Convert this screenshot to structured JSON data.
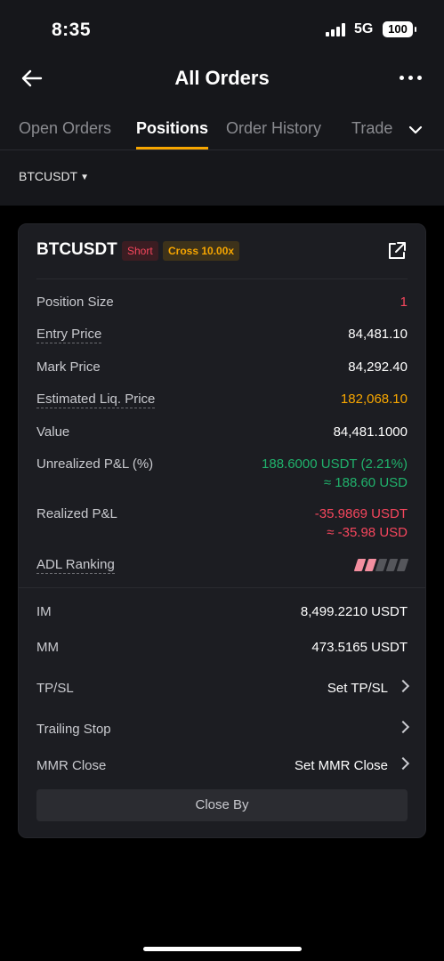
{
  "status_bar": {
    "time": "8:35",
    "network": "5G",
    "battery": "100"
  },
  "header": {
    "title": "All Orders"
  },
  "tabs": [
    {
      "label": "Open Orders"
    },
    {
      "label": "Positions"
    },
    {
      "label": "Order History"
    },
    {
      "label": "Trade"
    }
  ],
  "active_tab": "Positions",
  "filter": {
    "symbol": "BTCUSDT"
  },
  "position": {
    "symbol": "BTCUSDT",
    "side_badge": "Short",
    "margin_badge": "Cross 10.00x",
    "rows": {
      "position_size": {
        "label": "Position Size",
        "value": "1"
      },
      "entry_price": {
        "label": "Entry Price",
        "value": "84,481.10"
      },
      "mark_price": {
        "label": "Mark Price",
        "value": "84,292.40"
      },
      "est_liq_price": {
        "label": "Estimated Liq. Price",
        "value": "182,068.10"
      },
      "value": {
        "label": "Value",
        "value": "84,481.1000"
      },
      "unrealized_pnl": {
        "label": "Unrealized P&L (%)",
        "value": "188.6000 USDT (2.21%)",
        "sub_value": "≈ 188.60 USD"
      },
      "realized_pnl": {
        "label": "Realized P&L",
        "value": "-35.9869 USDT",
        "sub_value": "≈ -35.98 USD"
      },
      "adl_ranking": {
        "label": "ADL Ranking",
        "level": 2,
        "max_level": 5
      },
      "im": {
        "label": "IM",
        "value": "8,499.2210 USDT"
      },
      "mm": {
        "label": "MM",
        "value": "473.5165 USDT"
      },
      "tpsl": {
        "label": "TP/SL",
        "action": "Set TP/SL"
      },
      "trailing_stop": {
        "label": "Trailing Stop"
      },
      "mmr_close": {
        "label": "MMR Close",
        "action": "Set MMR Close"
      }
    },
    "close_by_label": "Close By"
  },
  "colors": {
    "accent": "#f7a600",
    "loss": "#f6465d",
    "profit": "#20b26c"
  }
}
